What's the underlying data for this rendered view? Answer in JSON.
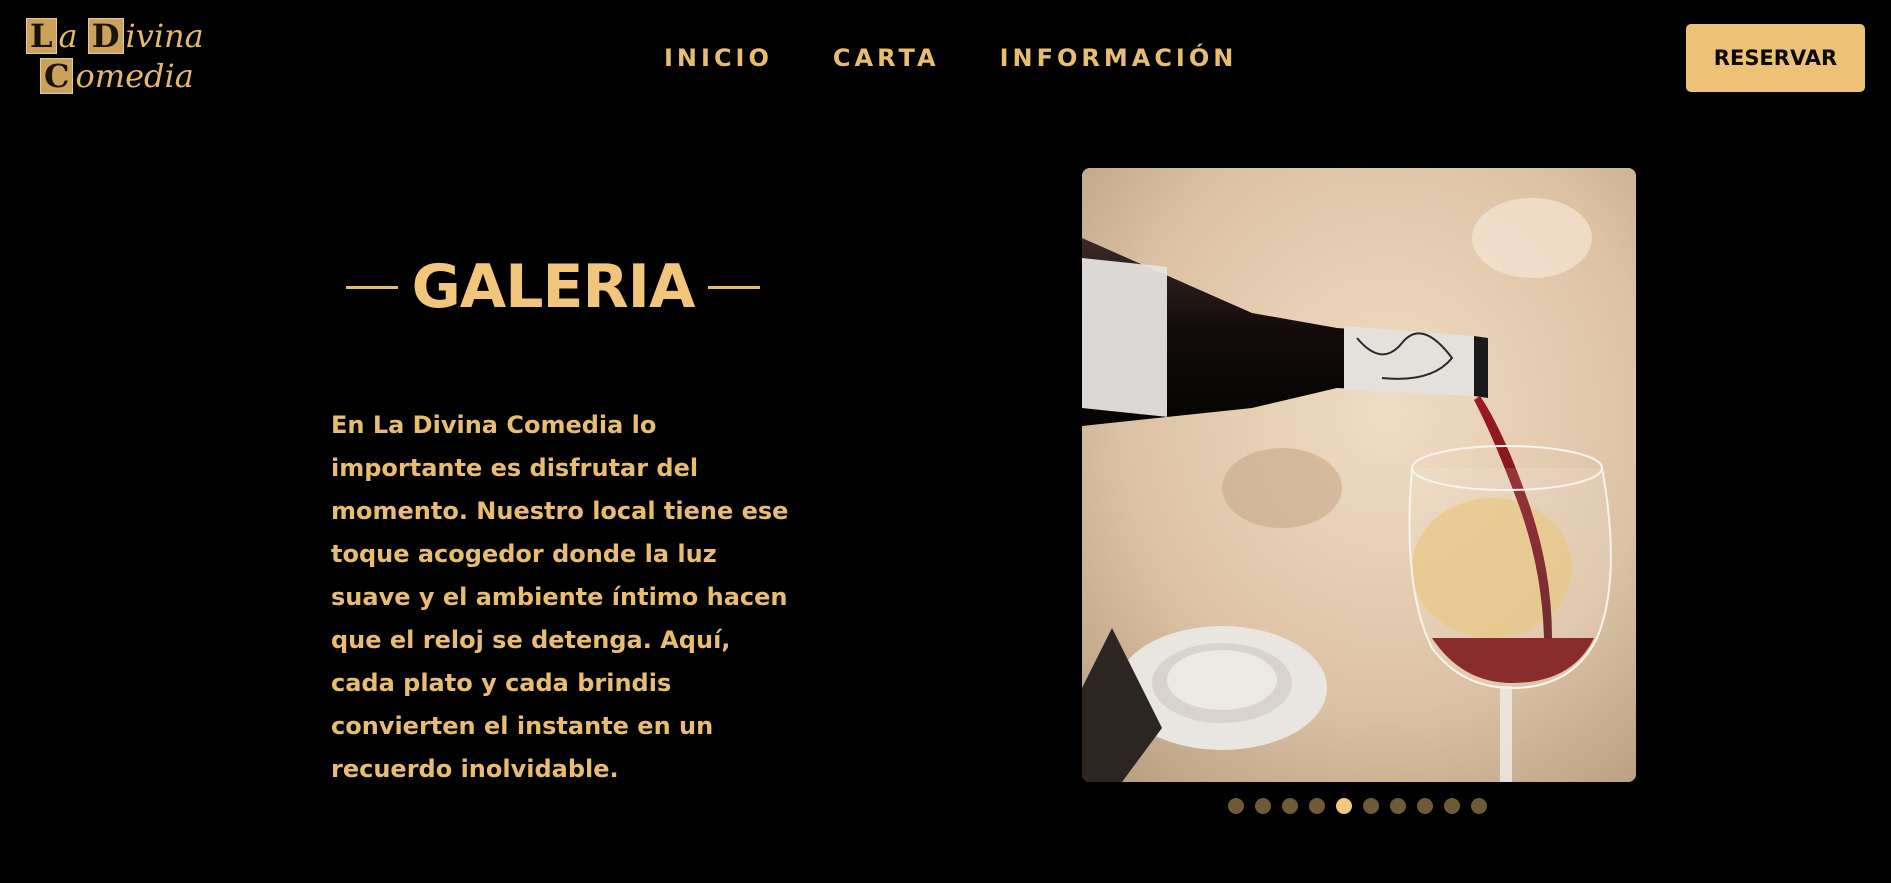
{
  "brand": {
    "logo_line1_cap": "L",
    "logo_line1_rest": "a",
    "logo_line1_cap2": "D",
    "logo_line1_rest2": "ivina",
    "logo_line2_cap": "C",
    "logo_line2_rest": "omedia"
  },
  "nav": {
    "items": [
      {
        "label": "INICIO"
      },
      {
        "label": "CARTA"
      },
      {
        "label": "INFORMACIÓN"
      }
    ]
  },
  "header": {
    "reserve_label": "RESERVAR"
  },
  "gallery": {
    "title": "GALERIA",
    "description": "En La Divina Comedia lo importante es disfrutar del momento. Nuestro local tiene ese toque acogedor donde la luz suave y el ambiente íntimo hacen que el reloj se detenga. Aquí, cada plato y cada brindis convierten el instante en un recuerdo inolvidable.",
    "slide_count": 10,
    "active_slide": 5
  },
  "colors": {
    "accent": "#e9bd6f",
    "button_bg": "#edc276",
    "background": "#000000",
    "dot_inactive": "#6e5a34",
    "dot_active": "#f2c97c"
  }
}
